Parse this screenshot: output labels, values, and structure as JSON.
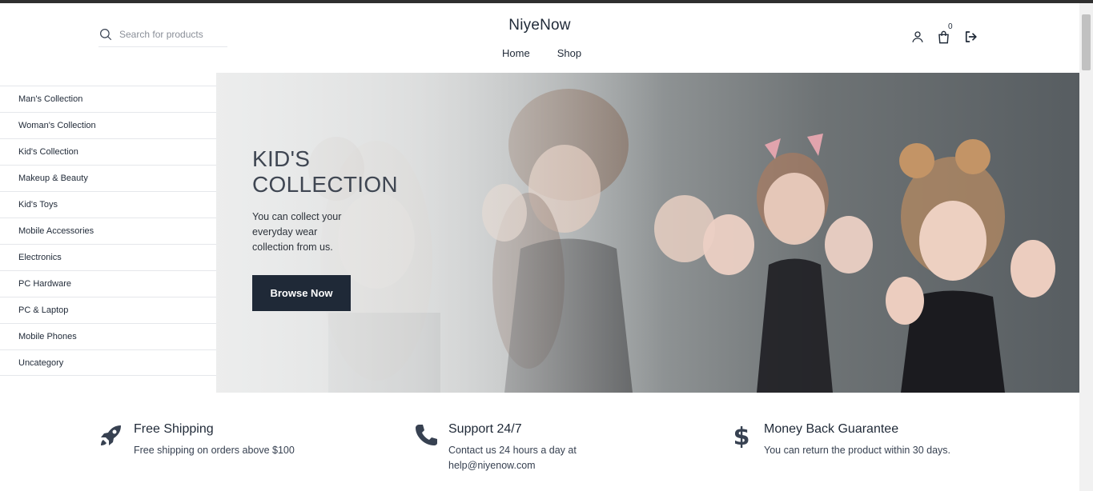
{
  "header": {
    "brand": "NiyeNow",
    "search_placeholder": "Search for products",
    "nav": [
      {
        "label": "Home"
      },
      {
        "label": "Shop"
      }
    ],
    "cart_count": "0"
  },
  "sidebar": {
    "items": [
      {
        "label": "Man's Collection"
      },
      {
        "label": "Woman's Collection"
      },
      {
        "label": "Kid's Collection"
      },
      {
        "label": "Makeup & Beauty"
      },
      {
        "label": "Kid's Toys"
      },
      {
        "label": "Mobile Accessories"
      },
      {
        "label": "Electronics"
      },
      {
        "label": "PC Hardware"
      },
      {
        "label": "PC & Laptop"
      },
      {
        "label": "Mobile Phones"
      },
      {
        "label": "Uncategory"
      }
    ]
  },
  "hero": {
    "title_line1": "KID'S",
    "title_line2": "COLLECTION",
    "text": "You can collect your everyday wear collection from us.",
    "button": "Browse Now"
  },
  "features": [
    {
      "icon": "rocket-icon",
      "title": "Free Shipping",
      "text": "Free shipping on orders above $100"
    },
    {
      "icon": "phone-icon",
      "title": "Support 24/7",
      "text_line1": "Contact us 24 hours a day at",
      "text_line2": "help@niyenow.com"
    },
    {
      "icon": "dollar-icon",
      "title": "Money Back Guarantee",
      "text": "You can return the product within 30 days."
    }
  ],
  "colors": {
    "dark": "#1f2937",
    "border": "#e5e7eb"
  }
}
